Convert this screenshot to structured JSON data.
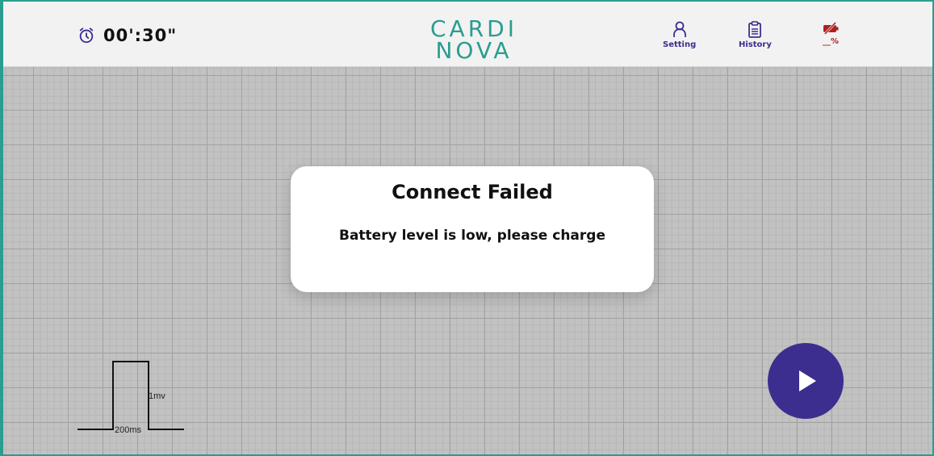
{
  "header": {
    "timer": "00':30\"",
    "logo": {
      "line1": "CARDI",
      "line2": "NOVA"
    },
    "nav": {
      "setting_label": "Setting",
      "history_label": "History",
      "battery_label": "__%"
    }
  },
  "calibration": {
    "amplitude_label": "1mv",
    "duration_label": "200ms"
  },
  "dialog": {
    "title": "Connect Failed",
    "message": "Battery level is low, please charge"
  },
  "icons": {
    "timer": "alarm-clock-icon",
    "setting": "user-icon",
    "history": "clipboard-icon",
    "battery": "battery-off-icon",
    "play": "play-icon"
  },
  "colors": {
    "brand": "#2a9d8f",
    "accent": "#3b2e8f",
    "warning": "#b02020"
  }
}
